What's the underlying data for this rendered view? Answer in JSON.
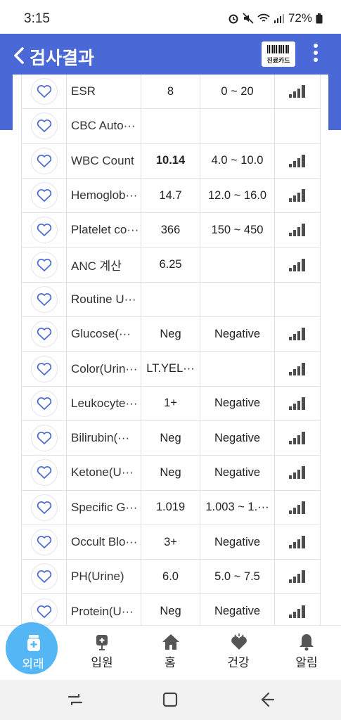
{
  "status_bar": {
    "time": "3:15",
    "battery": "72%"
  },
  "header": {
    "title": "검사결과",
    "card_button_label": "진료카드"
  },
  "results": [
    {
      "name": "ESR",
      "value": "8",
      "reference": "0 ~ 20",
      "bold": false,
      "chart": true
    },
    {
      "name": "CBC Auto···",
      "value": "",
      "reference": "",
      "bold": false,
      "chart": false
    },
    {
      "name": "WBC Count",
      "value": "10.14",
      "reference": "4.0 ~ 10.0",
      "bold": true,
      "chart": true
    },
    {
      "name": "Hemoglob···",
      "value": "14.7",
      "reference": "12.0 ~ 16.0",
      "bold": false,
      "chart": true
    },
    {
      "name": "Platelet co···",
      "value": "366",
      "reference": "150 ~ 450",
      "bold": false,
      "chart": true
    },
    {
      "name": "ANC 계산",
      "value": "6.25",
      "reference": "",
      "bold": false,
      "chart": true
    },
    {
      "name": "Routine U···",
      "value": "",
      "reference": "",
      "bold": false,
      "chart": false
    },
    {
      "name": "Glucose(···",
      "value": "Neg",
      "reference": "Negative",
      "bold": false,
      "chart": true
    },
    {
      "name": "Color(Urin···",
      "value": "LT.YEL···",
      "reference": "",
      "bold": false,
      "chart": true
    },
    {
      "name": "Leukocyte···",
      "value": "1+",
      "reference": "Negative",
      "bold": false,
      "chart": true
    },
    {
      "name": "Bilirubin(···",
      "value": "Neg",
      "reference": "Negative",
      "bold": false,
      "chart": true
    },
    {
      "name": "Ketone(U···",
      "value": "Neg",
      "reference": "Negative",
      "bold": false,
      "chart": true
    },
    {
      "name": "Specific G···",
      "value": "1.019",
      "reference": "1.003 ~ 1.···",
      "bold": false,
      "chart": true
    },
    {
      "name": "Occult Blo···",
      "value": "3+",
      "reference": "Negative",
      "bold": false,
      "chart": true
    },
    {
      "name": "PH(Urine)",
      "value": "6.0",
      "reference": "5.0 ~ 7.5",
      "bold": false,
      "chart": true
    },
    {
      "name": "Protein(U···",
      "value": "Neg",
      "reference": "Negative",
      "bold": false,
      "chart": true
    },
    {
      "name": "",
      "value": "",
      "reference": "",
      "bold": false,
      "chart": true
    }
  ],
  "tabs": [
    {
      "label": "외래",
      "icon": "outpatient-icon",
      "active": true
    },
    {
      "label": "입원",
      "icon": "inpatient-icon",
      "active": false
    },
    {
      "label": "홈",
      "icon": "home-icon",
      "active": false
    },
    {
      "label": "건강",
      "icon": "health-icon",
      "active": false
    },
    {
      "label": "알림",
      "icon": "bell-icon",
      "active": false
    }
  ],
  "colors": {
    "header": "#4a68d6",
    "accent": "#55b6f5",
    "heart": "#4a68d6",
    "chart": "#4d4d4d"
  }
}
